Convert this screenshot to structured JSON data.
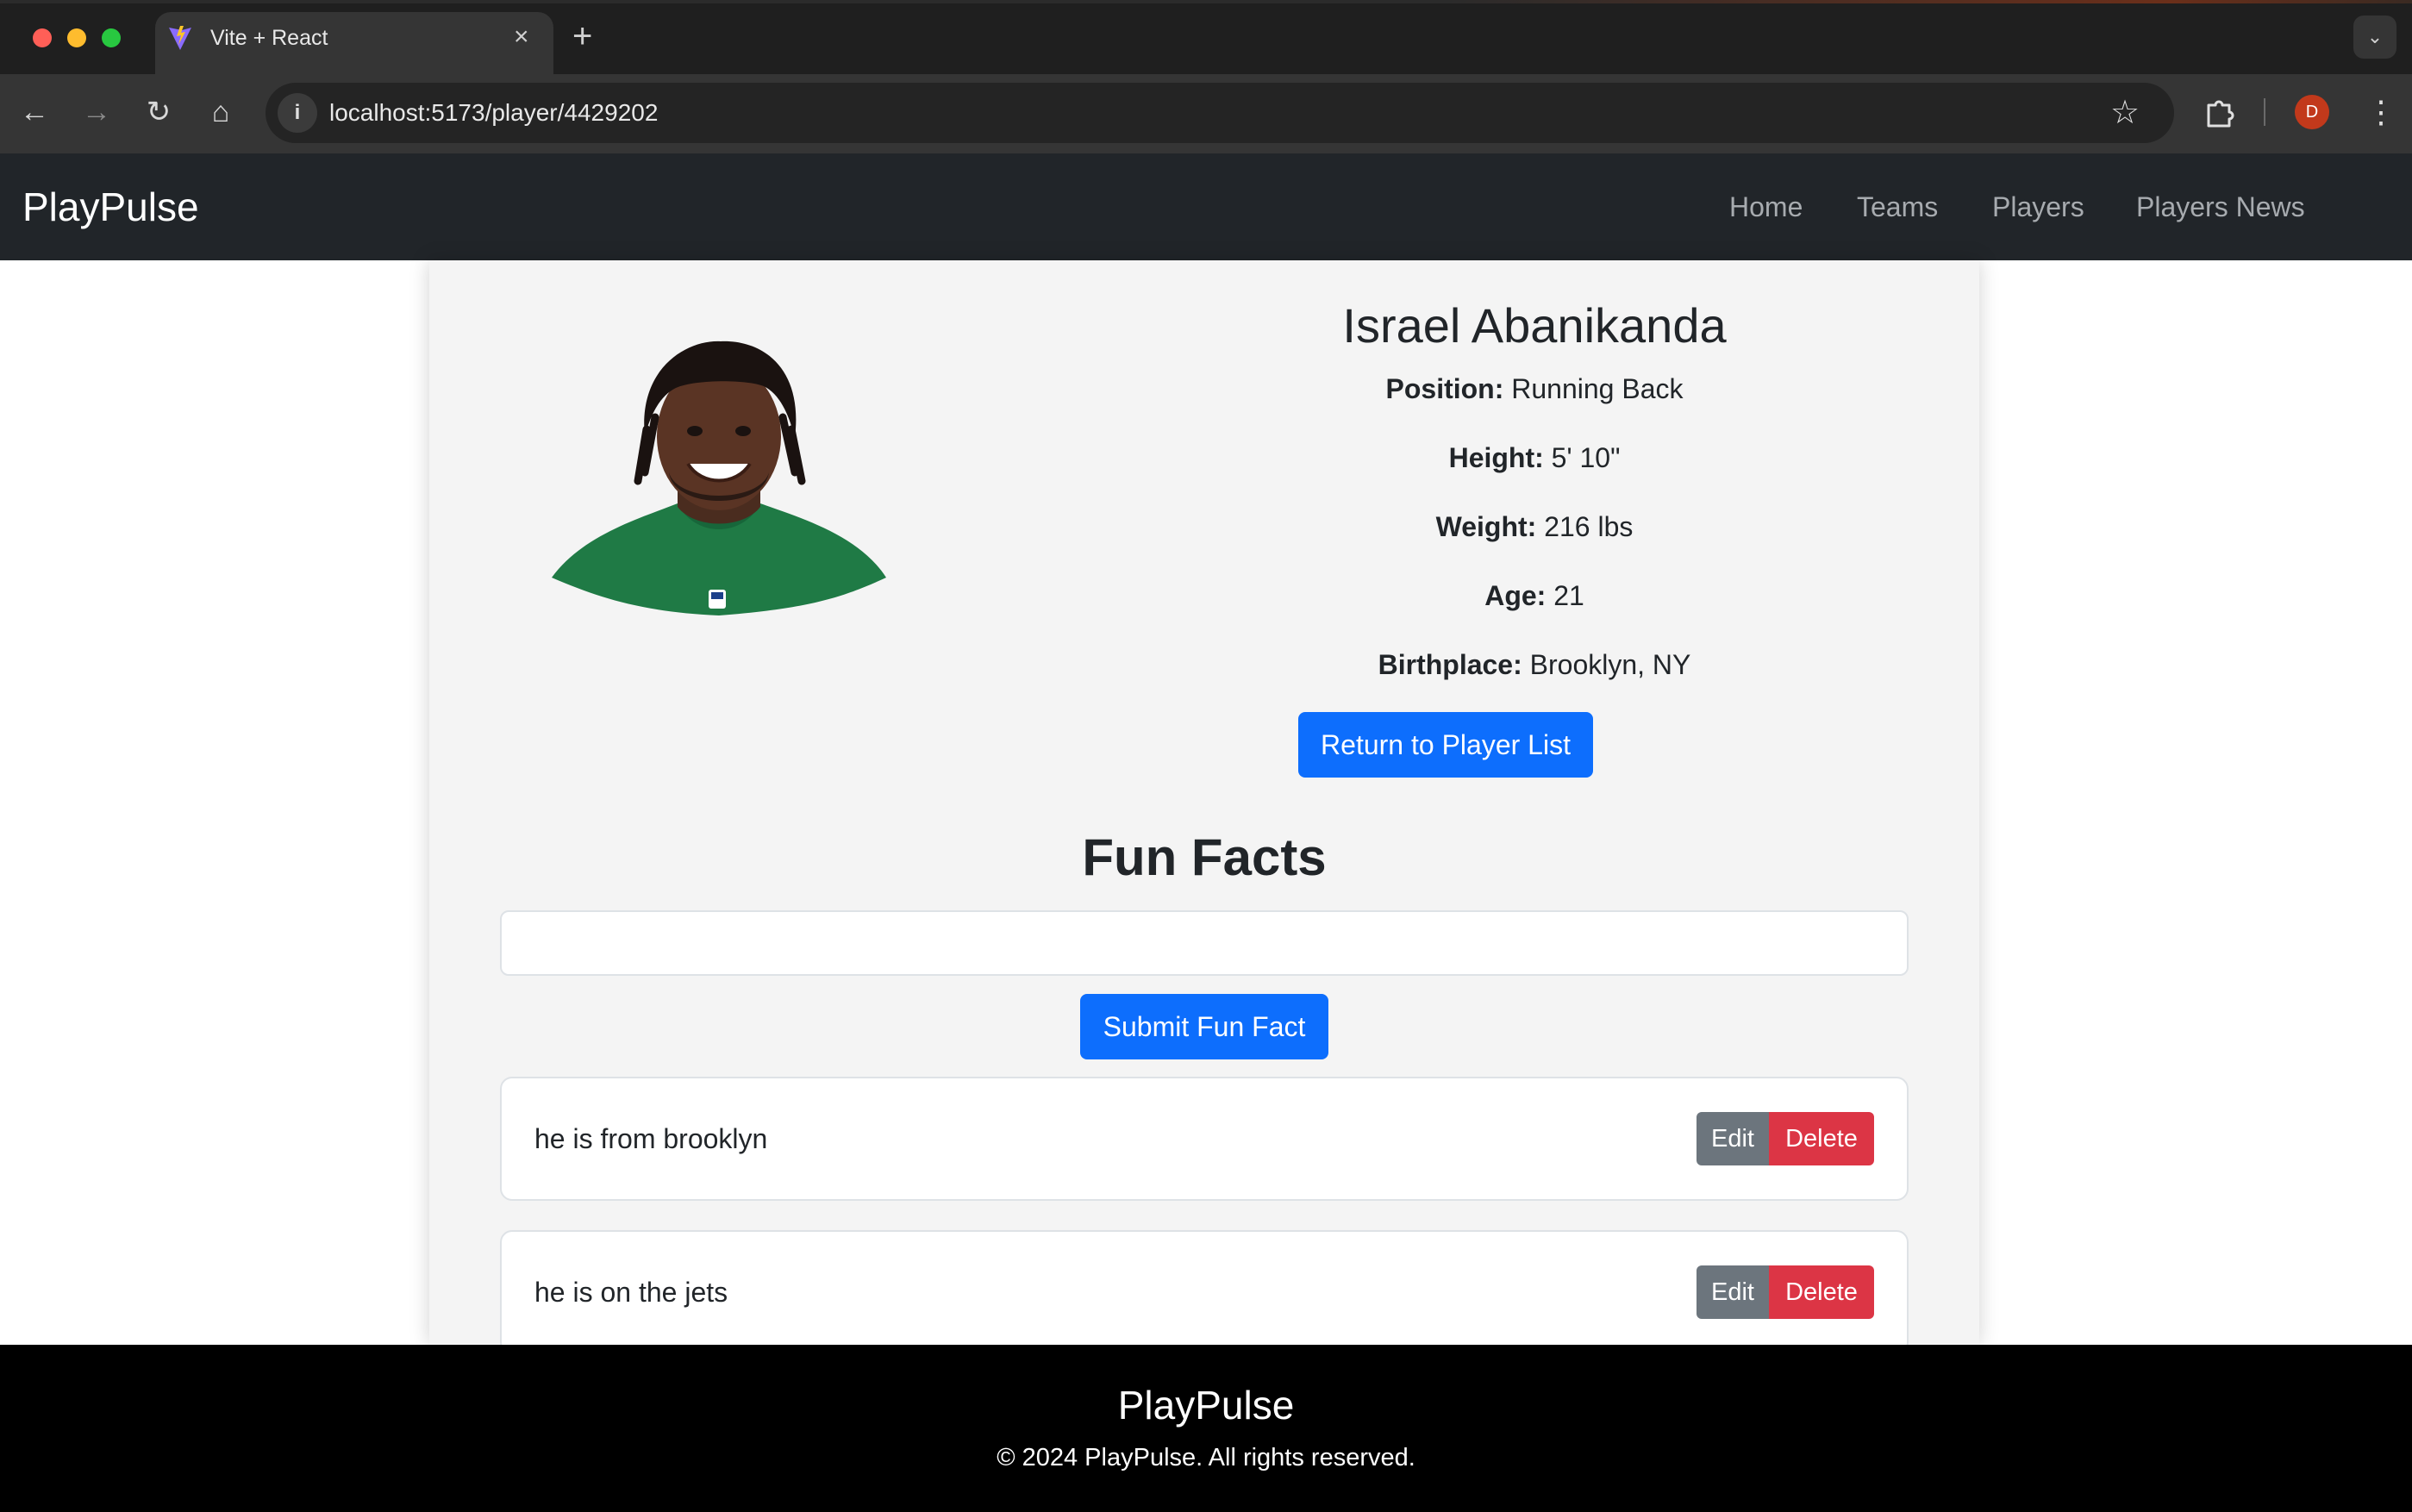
{
  "browser": {
    "tab_title": "Vite + React",
    "tab_close_icon": "×",
    "new_tab_icon": "+",
    "tab_list_icon": "⌄",
    "url": "localhost:5173/player/4429202",
    "back_icon": "←",
    "forward_icon": "→",
    "reload_icon": "↻",
    "home_icon": "⌂",
    "info_icon": "i",
    "star_icon": "☆",
    "profile_initial": "D",
    "menu_icon": "⋮"
  },
  "navbar": {
    "brand": "PlayPulse",
    "links": [
      "Home",
      "Teams",
      "Players",
      "Players News"
    ]
  },
  "player": {
    "name": "Israel Abanikanda",
    "position_label": "Position:",
    "position": "Running Back",
    "height_label": "Height:",
    "height": "5' 10\"",
    "weight_label": "Weight:",
    "weight": "216 lbs",
    "age_label": "Age:",
    "age": "21",
    "birthplace_label": "Birthplace:",
    "birthplace": "Brooklyn, NY",
    "return_button": "Return to Player List"
  },
  "fun_facts": {
    "title": "Fun Facts",
    "input_value": "",
    "submit_button": "Submit Fun Fact",
    "items": [
      {
        "text": "he is from brooklyn",
        "edit": "Edit",
        "delete": "Delete"
      },
      {
        "text": "he is on the jets",
        "edit": "Edit",
        "delete": "Delete"
      }
    ]
  },
  "footer": {
    "brand": "PlayPulse",
    "copyright": "© 2024 PlayPulse. All rights reserved."
  },
  "colors": {
    "primary": "#0d6efd",
    "secondary": "#6c757d",
    "danger": "#dc3545",
    "navbar": "#212529",
    "jersey_green": "#1f7a45"
  }
}
